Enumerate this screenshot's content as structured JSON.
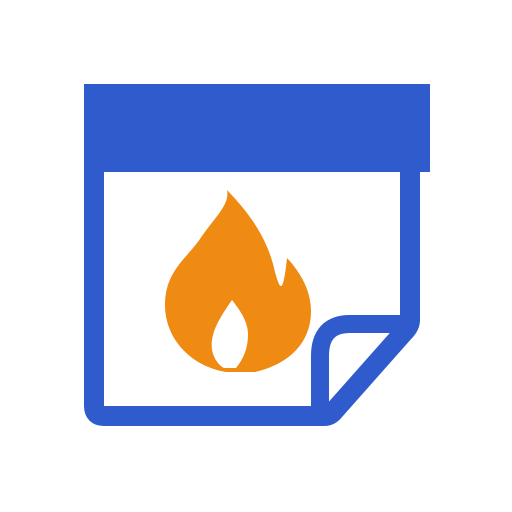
{
  "icon": {
    "name": "calendar-fire-icon",
    "colors": {
      "frame": "#2f5bcc",
      "flame": "#ef8a12",
      "background": "#ffffff"
    }
  }
}
